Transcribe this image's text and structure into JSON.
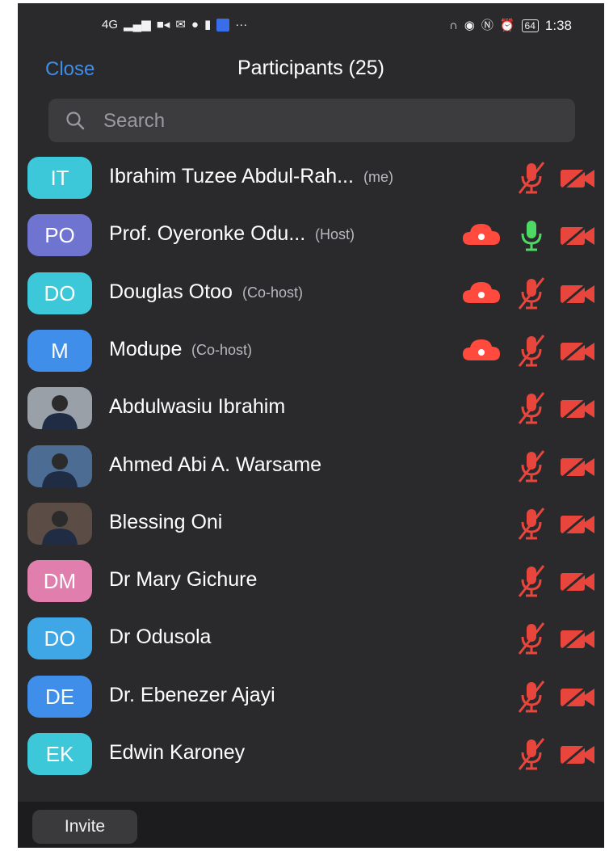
{
  "status_bar": {
    "network": "4G",
    "battery": "64",
    "time": "1:38",
    "icons_left": [
      "signal-icon",
      "video-icon",
      "mail-icon",
      "chat-icon",
      "battery-saver-icon",
      "app-icon",
      "more-icon"
    ],
    "icons_right": [
      "headphones-icon",
      "eye-icon",
      "nfc-icon",
      "alarm-icon"
    ]
  },
  "header": {
    "close_label": "Close",
    "title": "Participants (25)"
  },
  "search": {
    "placeholder": "Search"
  },
  "participants": [
    {
      "initials": "IT",
      "name": "Ibrahim Tuzee Abdul-Rah...",
      "tag": "(me)",
      "avatar_color": "#3cc8d8",
      "cloud": false,
      "mic": "muted",
      "video": "off"
    },
    {
      "initials": "PO",
      "name": "Prof. Oyeronke Odu...",
      "tag": "(Host)",
      "avatar_color": "#6f74d0",
      "cloud": true,
      "mic": "on",
      "video": "off"
    },
    {
      "initials": "DO",
      "name": "Douglas Otoo",
      "tag": "(Co-host)",
      "avatar_color": "#3cc8d8",
      "cloud": true,
      "mic": "muted",
      "video": "off"
    },
    {
      "initials": "M",
      "name": "Modupe",
      "tag": "(Co-host)",
      "avatar_color": "#3f8ee9",
      "cloud": true,
      "mic": "muted",
      "video": "off"
    },
    {
      "initials": "",
      "name": "Abdulwasiu Ibrahim",
      "tag": "",
      "avatar_color": "#9aa0a8",
      "cloud": false,
      "mic": "muted",
      "video": "off"
    },
    {
      "initials": "",
      "name": "Ahmed Abi A. Warsame",
      "tag": "",
      "avatar_color": "#4d6c93",
      "cloud": false,
      "mic": "muted",
      "video": "off"
    },
    {
      "initials": "",
      "name": "Blessing Oni",
      "tag": "",
      "avatar_color": "#5b4d45",
      "cloud": false,
      "mic": "muted",
      "video": "off"
    },
    {
      "initials": "DM",
      "name": "Dr Mary Gichure",
      "tag": "",
      "avatar_color": "#e07fae",
      "cloud": false,
      "mic": "muted",
      "video": "off"
    },
    {
      "initials": "DO",
      "name": "Dr Odusola",
      "tag": "",
      "avatar_color": "#3fa7e6",
      "cloud": false,
      "mic": "muted",
      "video": "off"
    },
    {
      "initials": "DE",
      "name": "Dr. Ebenezer Ajayi",
      "tag": "",
      "avatar_color": "#3f8ee9",
      "cloud": false,
      "mic": "muted",
      "video": "off"
    },
    {
      "initials": "EK",
      "name": "Edwin Karoney",
      "tag": "",
      "avatar_color": "#3cc8d8",
      "cloud": false,
      "mic": "muted",
      "video": "off"
    }
  ],
  "colors": {
    "muted_red": "#e8453c",
    "mic_green": "#4cd964",
    "accent_blue": "#3f8ee9"
  },
  "footer": {
    "invite_label": "Invite"
  }
}
